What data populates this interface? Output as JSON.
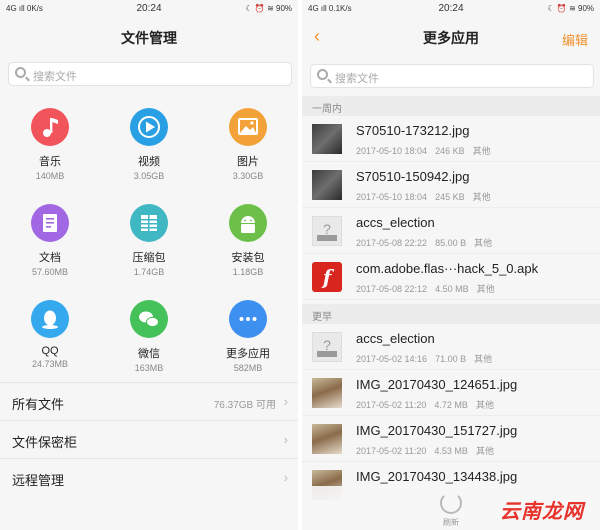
{
  "left": {
    "status": {
      "network": "4G ıll 0K/s",
      "time": "20:24",
      "right": "☾ ⏰ ≋ 90%"
    },
    "title": "文件管理",
    "search_placeholder": "搜索文件",
    "categories": [
      {
        "name": "音乐",
        "size": "140MB",
        "color": "#f2545b",
        "icon": "music-note-icon"
      },
      {
        "name": "视频",
        "size": "3.05GB",
        "color": "#2aa0e4",
        "icon": "play-icon"
      },
      {
        "name": "图片",
        "size": "3.30GB",
        "color": "#f3a23a",
        "icon": "image-icon"
      },
      {
        "name": "文档",
        "size": "57.60MB",
        "color": "#a268e4",
        "icon": "document-icon"
      },
      {
        "name": "压缩包",
        "size": "1.74GB",
        "color": "#3fb8c4",
        "icon": "archive-icon"
      },
      {
        "name": "安装包",
        "size": "1.18GB",
        "color": "#6cc04a",
        "icon": "android-icon"
      },
      {
        "name": "QQ",
        "size": "24.73MB",
        "color": "#34a9ee",
        "icon": "qq-icon"
      },
      {
        "name": "微信",
        "size": "163MB",
        "color": "#45c15a",
        "icon": "wechat-icon"
      },
      {
        "name": "更多应用",
        "size": "582MB",
        "color": "#3d8ff0",
        "icon": "more-dots-icon"
      }
    ],
    "rows": [
      {
        "label": "所有文件",
        "value": "76.37GB 可用"
      },
      {
        "label": "文件保密柜",
        "value": ""
      },
      {
        "label": "远程管理",
        "value": ""
      }
    ]
  },
  "right": {
    "status": {
      "network": "4G ıll 0.1K/s",
      "time": "20:24",
      "right": "☾ ⏰ ≋ 90%"
    },
    "title": "更多应用",
    "back": "‹",
    "edit": "编辑",
    "search_placeholder": "搜索文件",
    "sections": [
      {
        "label": "一周内",
        "files": [
          {
            "name": "S70510-173212.jpg",
            "date": "2017-05-10 18:04",
            "size": "246 KB",
            "tag": "其他",
            "thumb": "photo"
          },
          {
            "name": "S70510-150942.jpg",
            "date": "2017-05-10 18:04",
            "size": "245 KB",
            "tag": "其他",
            "thumb": "photo"
          },
          {
            "name": "accs_election",
            "date": "2017-05-08 22:22",
            "size": "85.00 B",
            "tag": "其他",
            "thumb": "unknown"
          },
          {
            "name": "com.adobe.flas···hack_5_0.apk",
            "date": "2017-05-08 22:12",
            "size": "4.50 MB",
            "tag": "其他",
            "thumb": "flash"
          }
        ]
      },
      {
        "label": "更早",
        "files": [
          {
            "name": "accs_election",
            "date": "2017-05-02 14:16",
            "size": "71.00 B",
            "tag": "其他",
            "thumb": "unknown"
          },
          {
            "name": "IMG_20170430_124651.jpg",
            "date": "2017-05-02 11:20",
            "size": "4.72 MB",
            "tag": "其他",
            "thumb": "photo2"
          },
          {
            "name": "IMG_20170430_151727.jpg",
            "date": "2017-05-02 11:20",
            "size": "4.53 MB",
            "tag": "其他",
            "thumb": "photo2"
          },
          {
            "name": "IMG_20170430_134438.jpg",
            "date": "",
            "size": "",
            "tag": "",
            "thumb": "photo2"
          }
        ]
      }
    ],
    "refresh_label": "刷新",
    "watermark": "云南龙网",
    "unknown_glyph": "?",
    "flash_glyph": "f"
  },
  "accent": "#f0922d"
}
